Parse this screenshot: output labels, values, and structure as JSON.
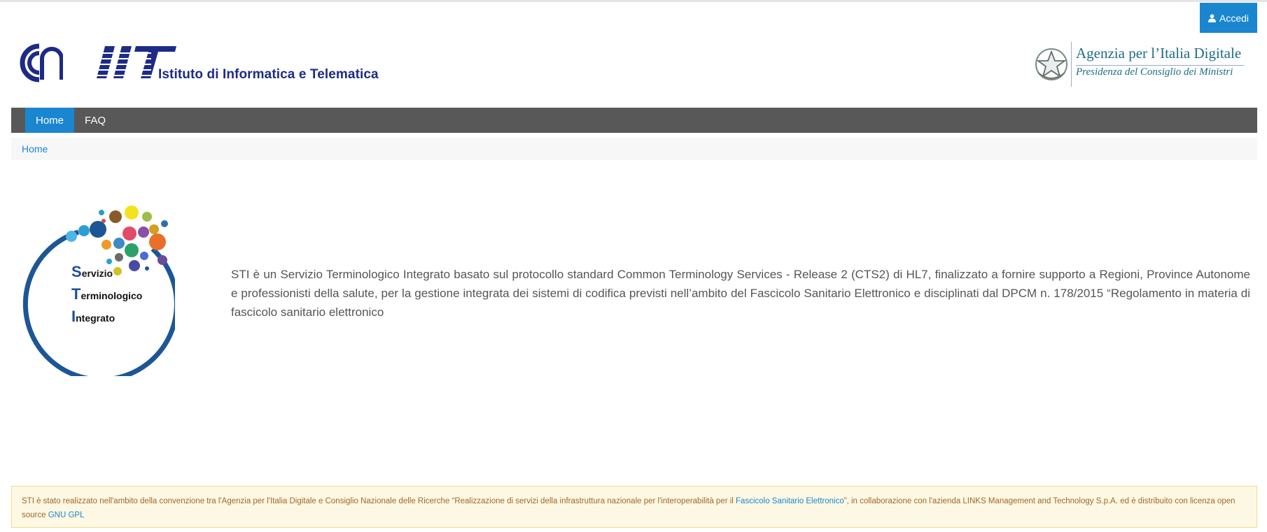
{
  "header": {
    "login_label": "Accedi",
    "iit_name": "Istituto di Informatica e Telematica",
    "agid_title": "Agenzia per l’Italia Digitale",
    "agid_subtitle": "Presidenza del Consiglio dei Ministri",
    "iit_logo_text": "IIT"
  },
  "nav": {
    "items": [
      {
        "label": "Home",
        "active": true
      },
      {
        "label": "FAQ",
        "active": false
      }
    ]
  },
  "breadcrumb": {
    "home": "Home"
  },
  "logo_sti": {
    "line1_cap": "S",
    "line1_rest": "ervizio",
    "line2_cap": "T",
    "line2_rest": "erminologico",
    "line3_cap": "I",
    "line3_rest": "ntegrato"
  },
  "main": {
    "description": "STI è un Servizio Terminologico Integrato basato sul protocollo standard Common Terminology Services - Release 2 (CTS2) di HL7, finalizzato a fornire supporto a Regioni, Province Autonome e professionisti della salute, per la gestione integrata dei sistemi di codifica previsti nell’ambito del Fascicolo Sanitario Elettronico e disciplinati dal DPCM n. 178/2015 “Regolamento in materia di fascicolo sanitario elettronico"
  },
  "footer": {
    "text_before": "STI  è stato realizzato nell'ambito della convenzione tra l'Agenzia per l'Italia Digitale e Consiglio Nazionale delle Ricerche “Realizzazione di servizi della infrastruttura nazionale per l'interoperabilità per il ",
    "link_fse": "Fascicolo Sanitario Elettronico",
    "text_middle": "”, in collaborazione con l'azienda LINKS Management and Technology S.p.A. ed è distribuito con licenza open source ",
    "link_license": "GNU GPL"
  },
  "colors": {
    "accent": "#1a86d0",
    "navbar": "#585858",
    "footer_bg": "#fdf8e3",
    "footer_text": "#a0672a"
  }
}
